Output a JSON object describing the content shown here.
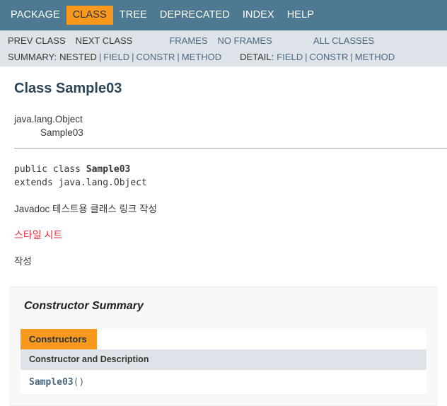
{
  "top_nav": {
    "items": [
      {
        "label": "PACKAGE",
        "active": false
      },
      {
        "label": "CLASS",
        "active": true
      },
      {
        "label": "TREE",
        "active": false
      },
      {
        "label": "DEPRECATED",
        "active": false
      },
      {
        "label": "INDEX",
        "active": false
      },
      {
        "label": "HELP",
        "active": false
      }
    ]
  },
  "sub_nav": {
    "prev_class": "PREV CLASS",
    "next_class": "NEXT CLASS",
    "frames": "FRAMES",
    "no_frames": "NO FRAMES",
    "all_classes": "ALL CLASSES",
    "summary_label": "SUMMARY:",
    "summary_nested": "NESTED",
    "summary_field": "FIELD",
    "summary_constr": "CONSTR",
    "summary_method": "METHOD",
    "detail_label": "DETAIL:",
    "detail_field": "FIELD",
    "detail_constr": "CONSTR",
    "detail_method": "METHOD",
    "separator": "|"
  },
  "main": {
    "page_title": "Class Sample03",
    "hierarchy": {
      "level_1": "java.lang.Object",
      "level_2": "Sample03"
    },
    "declaration": {
      "modifiers": "public class ",
      "class_name": "Sample03",
      "extends_line": "extends java.lang.Object"
    },
    "description": "Javadoc 테스트용 클래스 링크 작성",
    "description_link": "스타일 시트",
    "description_extra": "작성"
  },
  "constructor_summary": {
    "title": "Constructor Summary",
    "tab_label": "Constructors",
    "column_header": "Constructor and Description",
    "rows": [
      {
        "name": "Sample03",
        "signature": "()"
      }
    ]
  },
  "colors": {
    "nav_bar": "#4D7A90",
    "accent_orange": "#F8981D",
    "sub_nav_bg": "#DEE3E9",
    "link_blue": "#4A6782",
    "title_blue": "#2C4557",
    "red_link": "#EE2C3C",
    "panel_bg": "#F8F8F8",
    "text": "#353833"
  }
}
